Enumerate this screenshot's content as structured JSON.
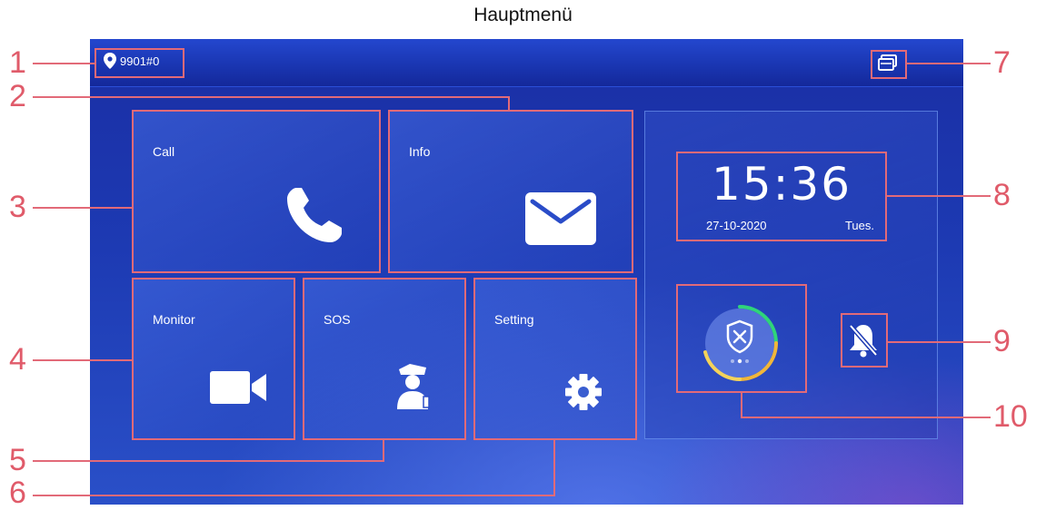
{
  "figure_title": "Hauptmenü",
  "status_bar": {
    "location_icon": "location-pin-icon",
    "room_number": "9901#0",
    "window_icon": "multi-window-icon"
  },
  "tiles": {
    "call": {
      "label": "Call",
      "icon": "phone-icon"
    },
    "info": {
      "label": "Info",
      "icon": "envelope-icon"
    },
    "monitor": {
      "label": "Monitor",
      "icon": "video-camera-icon"
    },
    "sos": {
      "label": "SOS",
      "icon": "guard-icon"
    },
    "setting": {
      "label": "Setting",
      "icon": "gear-icon"
    }
  },
  "clock": {
    "time": "15:36",
    "date": "27-10-2020",
    "day": "Tues."
  },
  "arm_button": {
    "icon": "shield-x-icon"
  },
  "dnd": {
    "icon": "bell-muted-icon"
  },
  "callouts": [
    "1",
    "2",
    "3",
    "4",
    "5",
    "6",
    "7",
    "8",
    "9",
    "10"
  ],
  "colors": {
    "annotation": "#e26a78",
    "screen_bg": "#1d3ab3"
  }
}
